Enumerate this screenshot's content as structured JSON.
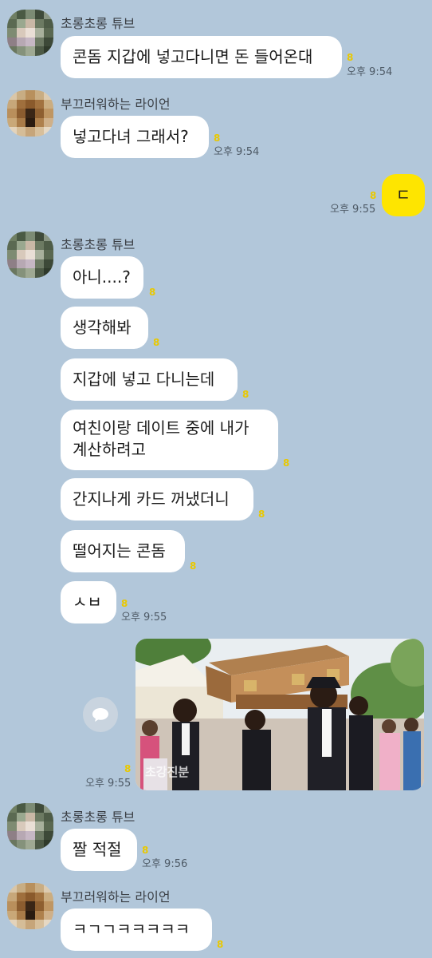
{
  "senders": {
    "tube": "초롱초롱 튜브",
    "lion": "부끄러워하는 라이언"
  },
  "messages": {
    "m1": {
      "text": "콘돔 지갑에 넣고다니면 돈 들어온대",
      "unread": "8",
      "time": "오후 9:54"
    },
    "m2": {
      "text": "넣고다녀 그래서?",
      "unread": "8",
      "time": "오후 9:54"
    },
    "m3": {
      "text": "ㄷ",
      "unread": "8",
      "time": "오후 9:55"
    },
    "m4": {
      "text": "아니....?",
      "unread": "8"
    },
    "m5": {
      "text": "생각해봐",
      "unread": "8"
    },
    "m6": {
      "text": "지갑에 넣고 다니는데",
      "unread": "8"
    },
    "m7": {
      "text": "여친이랑 데이트 중에 내가\n계산하려고",
      "unread": "8"
    },
    "m8": {
      "text": "간지나게 카드 꺼냈더니",
      "unread": "8"
    },
    "m9": {
      "text": "떨어지는 콘돔",
      "unread": "8"
    },
    "m10": {
      "text": "ㅅㅂ",
      "unread": "8",
      "time": "오후 9:55"
    },
    "m11": {
      "image": "coffin-dance-photo",
      "caption": "초강진분",
      "unread": "8",
      "time": "오후 9:55",
      "icon": "share-bubble-icon"
    },
    "m12": {
      "text": "짤 적절",
      "unread": "8",
      "time": "오후 9:56"
    },
    "m13": {
      "text": "ㅋㄱㄱㅋㅋㅋㅋㅋ",
      "unread": "8"
    }
  },
  "colors": {
    "background": "#b2c7da",
    "incoming_bubble": "#ffffff",
    "outgoing_bubble": "#fee500",
    "unread_count": "#e9c800"
  }
}
